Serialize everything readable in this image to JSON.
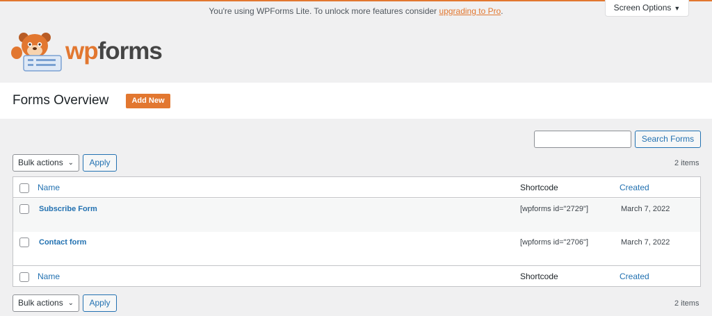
{
  "notice": {
    "text": "You're using WPForms Lite. To unlock more features consider ",
    "link": "upgrading to Pro",
    "suffix": "."
  },
  "screen_options": {
    "label": "Screen Options"
  },
  "logo": {
    "text_wp": "wp",
    "text_forms": "forms"
  },
  "page": {
    "title": "Forms Overview",
    "add_new": "Add New"
  },
  "search": {
    "button": "Search Forms",
    "value": ""
  },
  "bulk_top": {
    "label": "Bulk actions",
    "apply": "Apply",
    "count": "2 items"
  },
  "bulk_bottom": {
    "label": "Bulk actions",
    "apply": "Apply",
    "count": "2 items"
  },
  "table": {
    "columns": {
      "name": "Name",
      "shortcode": "Shortcode",
      "created": "Created"
    },
    "rows": [
      {
        "name": "Subscribe Form",
        "shortcode": "[wpforms id=\"2729\"]",
        "created": "March 7, 2022"
      },
      {
        "name": "Contact form",
        "shortcode": "[wpforms id=\"2706\"]",
        "created": "March 7, 2022"
      }
    ]
  },
  "colors": {
    "accent": "#e27730",
    "link": "#2271b1"
  }
}
